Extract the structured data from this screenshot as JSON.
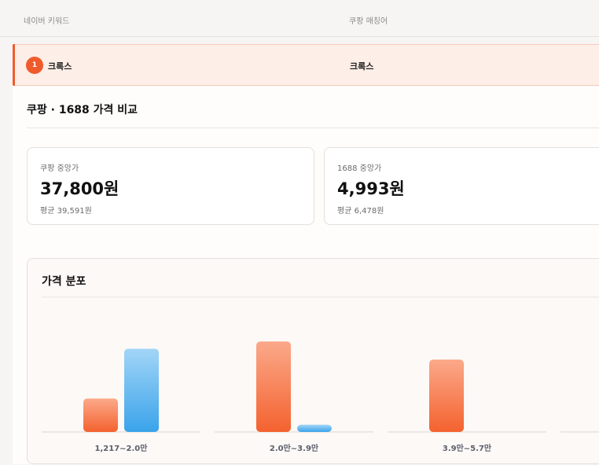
{
  "table_header": {
    "naver_keyword": "네이버 키워드",
    "coupang_matching": "쿠팡 매칭어"
  },
  "match_row": {
    "rank": "1",
    "naver_keyword": "크록스",
    "coupang_keyword": "크록스"
  },
  "comparison": {
    "title": "쿠팡 · 1688 가격 비교",
    "coupang": {
      "label": "쿠팡 중앙가",
      "value": "37,800원",
      "average": "평균 39,591원"
    },
    "china1688": {
      "label": "1688 중앙가",
      "value": "4,993원",
      "average": "평균 6,478원"
    }
  },
  "colors": {
    "coupang": "#f4622f",
    "china1688": "#3aa3ea",
    "accent": "#f05b2c"
  },
  "chart_data": {
    "type": "bar",
    "title": "가격 분포",
    "categories": [
      "1,217~2.0만",
      "2.0만~3.9만",
      "3.9만~5.7만",
      ""
    ],
    "series": [
      {
        "name": "",
        "color": "#f4622f",
        "values": [
          0.37,
          1.0,
          0.8,
          0
        ]
      },
      {
        "name": "",
        "color": "#3aa3ea",
        "values": [
          0.92,
          0.08,
          0,
          0
        ]
      }
    ],
    "ylim": [
      0,
      1
    ],
    "grid": false,
    "legend": "none"
  }
}
